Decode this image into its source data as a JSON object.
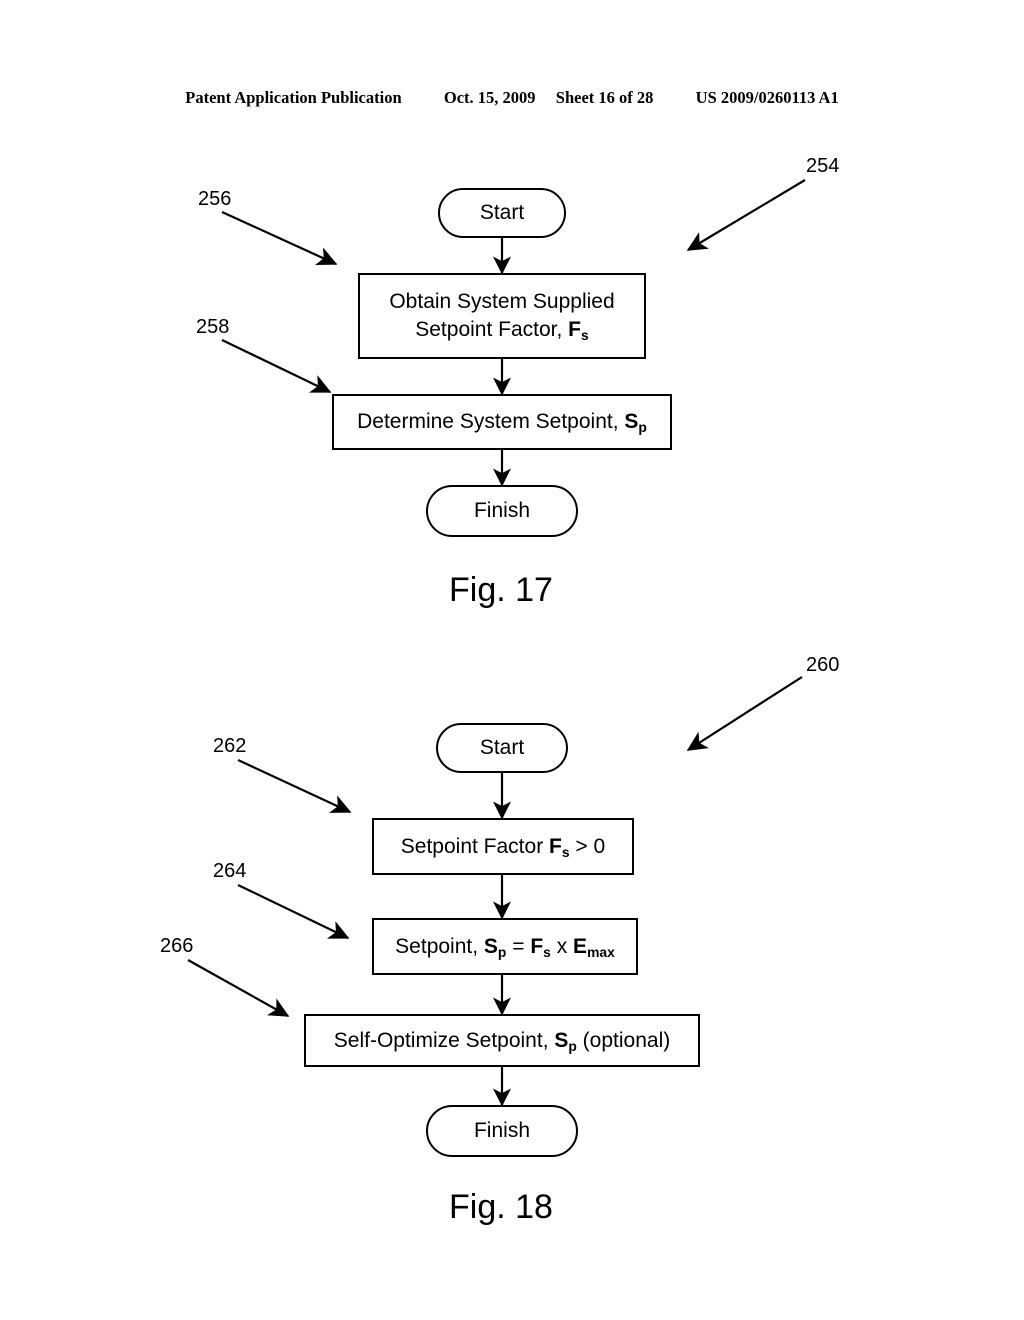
{
  "header": {
    "publication": "Patent Application Publication",
    "date": "Oct. 15, 2009",
    "sheet": "Sheet 16 of 28",
    "pub_number": "US 2009/0260113 A1"
  },
  "figures": [
    {
      "caption": "Fig. 17",
      "overall_ref": "254",
      "nodes": [
        {
          "id": "start",
          "type": "terminator",
          "label": "Start"
        },
        {
          "id": "obtain-factor",
          "type": "process",
          "line1": "Obtain System Supplied",
          "line2_pre": "Setpoint Factor, ",
          "line2_sym": "F",
          "line2_sub": "s"
        },
        {
          "id": "determine-setpoint",
          "type": "process",
          "pre": "Determine System Setpoint, ",
          "sym": "S",
          "sub": "p"
        },
        {
          "id": "finish",
          "type": "terminator",
          "label": "Finish"
        }
      ],
      "refs": [
        {
          "num": "256",
          "target": "obtain-factor"
        },
        {
          "num": "258",
          "target": "determine-setpoint"
        }
      ]
    },
    {
      "caption": "Fig. 18",
      "overall_ref": "260",
      "nodes": [
        {
          "id": "start",
          "type": "terminator",
          "label": "Start"
        },
        {
          "id": "setpoint-factor",
          "type": "process",
          "pre": "Setpoint Factor ",
          "sym": "F",
          "sub": "s",
          "post": " > 0"
        },
        {
          "id": "setpoint-equation",
          "type": "process",
          "pre": "Setpoint, ",
          "sym1": "S",
          "sub1": "p",
          "mid1": " = ",
          "sym2": "F",
          "sub2": "s",
          "mid2": " x ",
          "sym3": "E",
          "sub3": "max"
        },
        {
          "id": "self-optimize",
          "type": "process",
          "pre": "Self-Optimize Setpoint, ",
          "sym": "S",
          "sub": "p",
          "post": " (optional)"
        },
        {
          "id": "finish",
          "type": "terminator",
          "label": "Finish"
        }
      ],
      "refs": [
        {
          "num": "262",
          "target": "setpoint-factor"
        },
        {
          "num": "264",
          "target": "setpoint-equation"
        },
        {
          "num": "266",
          "target": "self-optimize"
        }
      ]
    }
  ],
  "colors": {
    "ink": "#000000",
    "paper": "#ffffff"
  }
}
